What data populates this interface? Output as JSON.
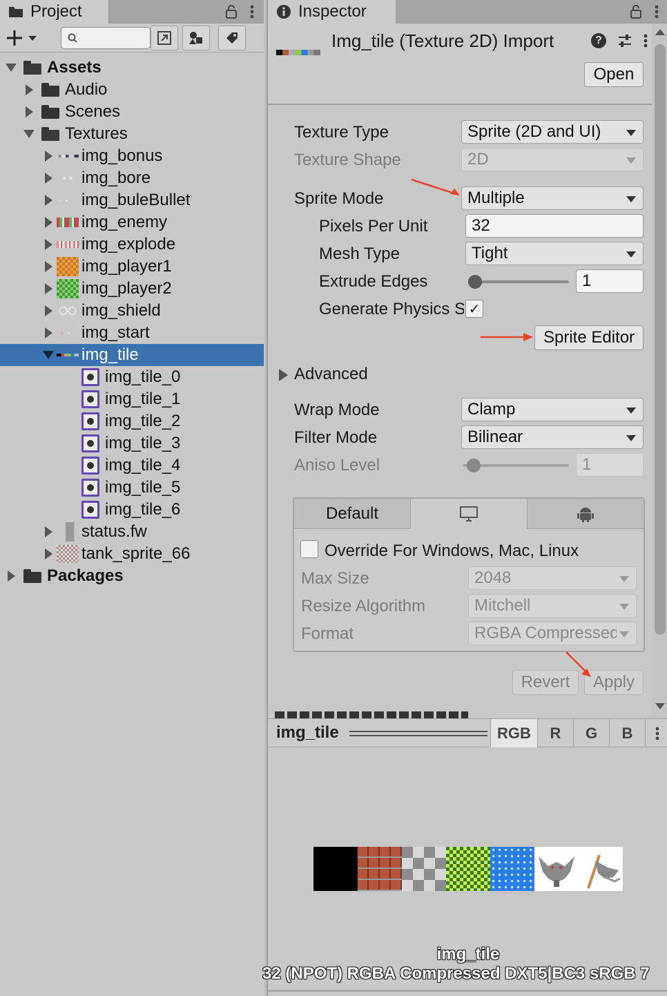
{
  "project": {
    "tab_label": "Project",
    "tree": [
      {
        "label": "Assets",
        "bold": true
      },
      {
        "label": "Audio"
      },
      {
        "label": "Scenes"
      },
      {
        "label": "Textures"
      },
      {
        "label": "img_bonus"
      },
      {
        "label": "img_bore"
      },
      {
        "label": "img_buleBullet"
      },
      {
        "label": "img_enemy"
      },
      {
        "label": "img_explode"
      },
      {
        "label": "img_player1"
      },
      {
        "label": "img_player2"
      },
      {
        "label": "img_shield"
      },
      {
        "label": "img_start"
      },
      {
        "label": "img_tile",
        "selected": true
      },
      {
        "label": "img_tile_0"
      },
      {
        "label": "img_tile_1"
      },
      {
        "label": "img_tile_2"
      },
      {
        "label": "img_tile_3"
      },
      {
        "label": "img_tile_4"
      },
      {
        "label": "img_tile_5"
      },
      {
        "label": "img_tile_6"
      },
      {
        "label": "status.fw"
      },
      {
        "label": "tank_sprite_66"
      },
      {
        "label": "Packages",
        "bold": true
      }
    ]
  },
  "inspector": {
    "tab_label": "Inspector",
    "title": "Img_tile (Texture 2D) Import",
    "open_label": "Open",
    "texture_type": {
      "label": "Texture Type",
      "value": "Sprite (2D and UI)"
    },
    "texture_shape": {
      "label": "Texture Shape",
      "value": "2D"
    },
    "sprite_mode": {
      "label": "Sprite Mode",
      "value": "Multiple"
    },
    "pixels_per_unit": {
      "label": "Pixels Per Unit",
      "value": "32"
    },
    "mesh_type": {
      "label": "Mesh Type",
      "value": "Tight"
    },
    "extrude_edges": {
      "label": "Extrude Edges",
      "value": "1",
      "slider_fraction": 0.03
    },
    "generate_physics": {
      "label": "Generate Physics Shape",
      "checked": true,
      "check_glyph": "✓"
    },
    "sprite_editor_label": "Sprite Editor",
    "advanced_label": "Advanced",
    "wrap_mode": {
      "label": "Wrap Mode",
      "value": "Clamp"
    },
    "filter_mode": {
      "label": "Filter Mode",
      "value": "Bilinear"
    },
    "aniso_level": {
      "label": "Aniso Level",
      "value": "1",
      "slider_fraction": 0.03
    },
    "platform": {
      "default_tab": "Default",
      "override_label": "Override For Windows, Mac, Linux",
      "max_size": {
        "label": "Max Size",
        "value": "2048"
      },
      "resize_algorithm": {
        "label": "Resize Algorithm",
        "value": "Mitchell"
      },
      "format": {
        "label": "Format",
        "value": "RGBA Compressed"
      }
    },
    "revert_label": "Revert",
    "apply_label": "Apply",
    "accent_arrow_color": "#e8412c"
  },
  "preview": {
    "name": "img_tile",
    "channels": [
      "RGB",
      "R",
      "G",
      "B"
    ],
    "caption_name": "img_tile",
    "caption_info": "32 (NPOT)  RGBA Compressed DXT5|BC3 sRGB  7"
  }
}
